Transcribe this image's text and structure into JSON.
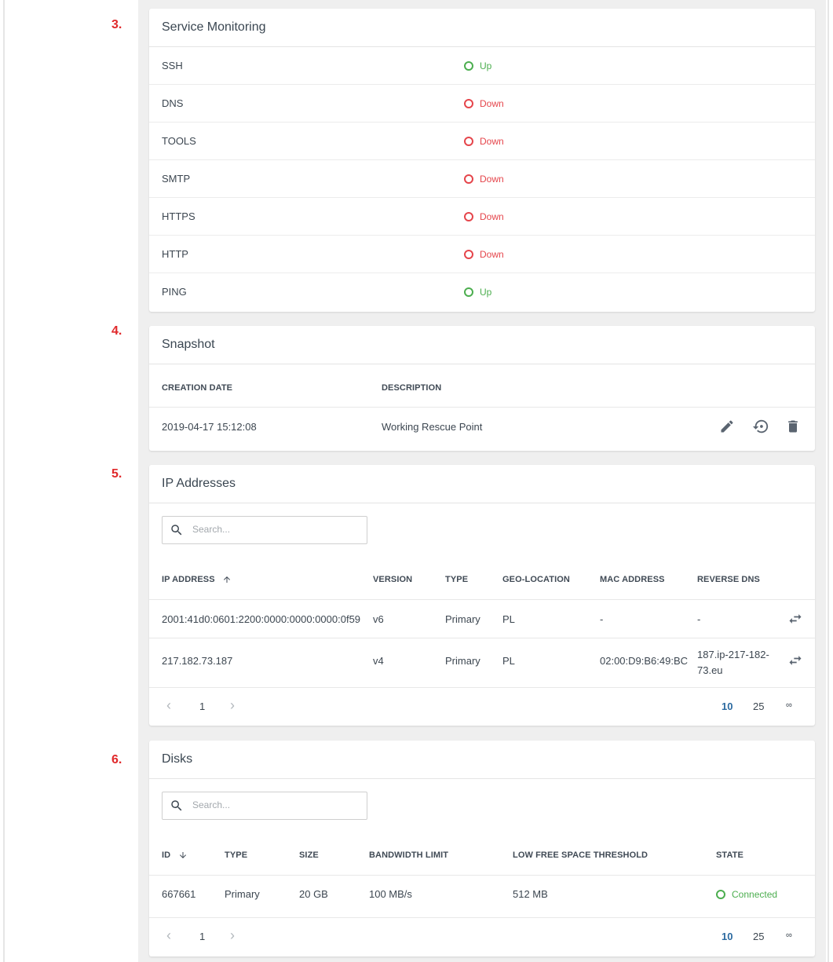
{
  "steps": [
    "3.",
    "4.",
    "5.",
    "6."
  ],
  "service_monitoring": {
    "title": "Service Monitoring",
    "rows": [
      {
        "name": "SSH",
        "status": "Up",
        "state": "up"
      },
      {
        "name": "DNS",
        "status": "Down",
        "state": "down"
      },
      {
        "name": "TOOLS",
        "status": "Down",
        "state": "down"
      },
      {
        "name": "SMTP",
        "status": "Down",
        "state": "down"
      },
      {
        "name": "HTTPS",
        "status": "Down",
        "state": "down"
      },
      {
        "name": "HTTP",
        "status": "Down",
        "state": "down"
      },
      {
        "name": "PING",
        "status": "Up",
        "state": "up"
      }
    ]
  },
  "snapshot": {
    "title": "Snapshot",
    "columns": [
      "CREATION DATE",
      "DESCRIPTION"
    ],
    "row": {
      "date": "2019-04-17 15:12:08",
      "description": "Working Rescue Point"
    },
    "actions": [
      "pencil-icon",
      "restore-icon",
      "trash-icon"
    ]
  },
  "ip_addresses": {
    "title": "IP Addresses",
    "search_placeholder": "Search...",
    "columns": [
      "IP ADDRESS",
      "VERSION",
      "TYPE",
      "GEO-LOCATION",
      "MAC ADDRESS",
      "REVERSE DNS"
    ],
    "sort_icon": "arrow-up-icon",
    "rows": [
      {
        "ip": "2001:41d0:0601:2200:0000:0000:0000:0f59",
        "version": "v6",
        "type": "Primary",
        "geo": "PL",
        "mac": "-",
        "rdns": "-"
      },
      {
        "ip": "217.182.73.187",
        "version": "v4",
        "type": "Primary",
        "geo": "PL",
        "mac": "02:00:D9:B6:49:BC",
        "rdns_line1": "187.ip-217-182-",
        "rdns_line2": "73.eu"
      }
    ],
    "pager": {
      "page": "1",
      "sizes": [
        "10",
        "25",
        "∞"
      ]
    }
  },
  "disks": {
    "title": "Disks",
    "search_placeholder": "Search...",
    "columns": [
      "ID",
      "TYPE",
      "SIZE",
      "BANDWIDTH LIMIT",
      "LOW FREE SPACE THRESHOLD",
      "STATE"
    ],
    "sort_icon": "arrow-down-icon",
    "row": {
      "id": "667661",
      "type": "Primary",
      "size": "20 GB",
      "bandwidth": "100 MB/s",
      "threshold": "512 MB",
      "state": "Connected"
    },
    "pager": {
      "page": "1",
      "sizes": [
        "10",
        "25",
        "∞"
      ]
    }
  },
  "colors": {
    "up": "#4cae4f",
    "down": "#e5454b",
    "step": "#e0282a",
    "pager_active": "#2c6aa0"
  }
}
